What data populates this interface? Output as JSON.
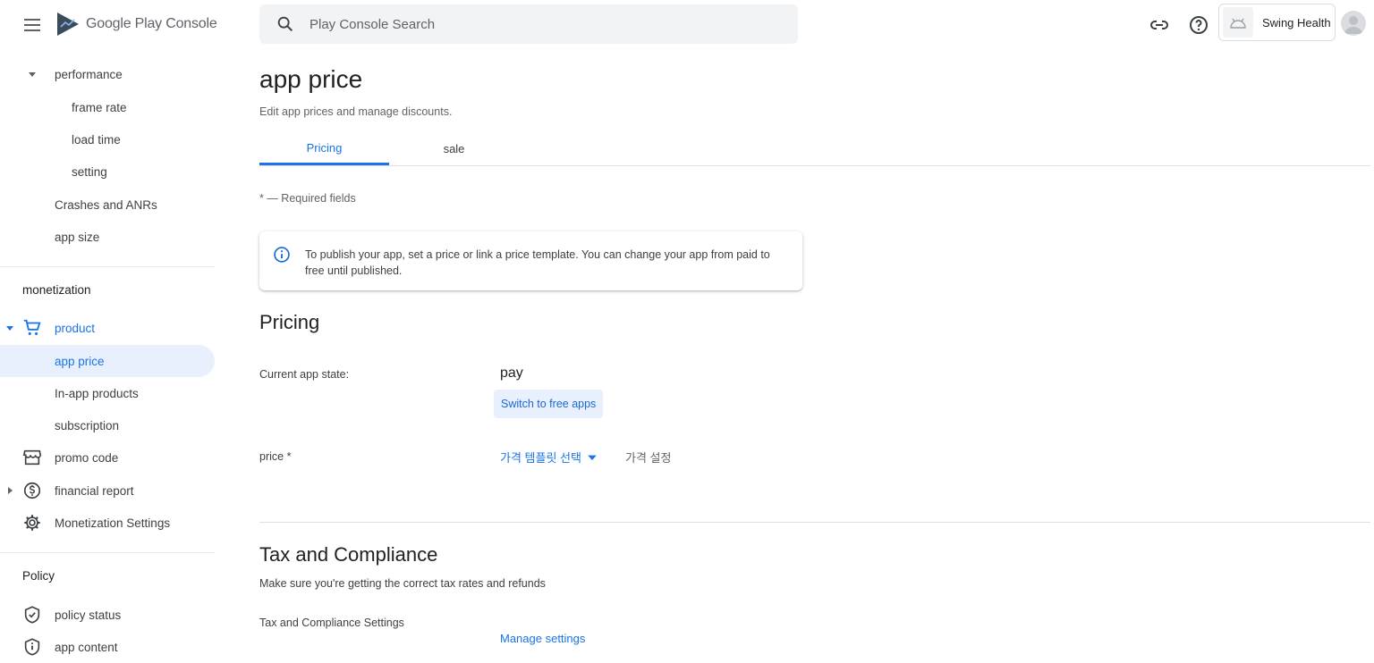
{
  "topbar": {
    "logo_text": "Google Play Console",
    "search_placeholder": "Play Console Search",
    "account_name": "Swing Health"
  },
  "sidebar": {
    "items": [
      {
        "label": "performance"
      },
      {
        "label": "frame rate"
      },
      {
        "label": "load time"
      },
      {
        "label": "setting"
      },
      {
        "label": "Crashes and ANRs"
      },
      {
        "label": "app size"
      }
    ],
    "monetization_title": "monetization",
    "monetization_items": [
      {
        "label": "product"
      },
      {
        "label": "app price"
      },
      {
        "label": "In-app products"
      },
      {
        "label": "subscription"
      },
      {
        "label": "promo code"
      },
      {
        "label": "financial report"
      },
      {
        "label": "Monetization Settings"
      }
    ],
    "policy_title": "Policy",
    "policy_items": [
      {
        "label": "policy status"
      },
      {
        "label": "app content"
      }
    ]
  },
  "main": {
    "title": "app price",
    "subtitle": "Edit app prices and manage discounts.",
    "tabs": [
      {
        "label": "Pricing"
      },
      {
        "label": "sale"
      }
    ],
    "required_note": "* — Required fields",
    "info_text": "To publish your app, set a price or link a price template. You can change your app from paid to free until published.",
    "pricing_title": "Pricing",
    "current_state_label": "Current app state:",
    "current_state_value": "pay",
    "switch_button": "Switch to free apps",
    "price_label": "price *",
    "price_template_link": "가격 템플릿 선택",
    "price_setting_text": "가격 설정",
    "tax_title": "Tax and Compliance",
    "tax_subtitle": "Make sure you're getting the correct tax rates and refunds",
    "tax_settings_label": "Tax and Compliance Settings",
    "manage_settings_link": "Manage settings"
  },
  "colors": {
    "accent": "#1a73e8",
    "active_bg": "#e8f0fe"
  }
}
